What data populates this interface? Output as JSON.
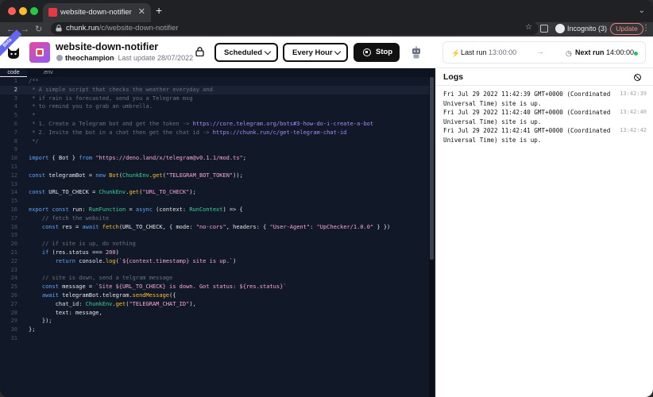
{
  "browser": {
    "tab_title": "website-down-notifier",
    "url_host": "chunk.run",
    "url_path": "/c/website-down-notifier",
    "incognito_label": "Incognito (3)",
    "update_label": "Update"
  },
  "header": {
    "beta_badge": "Beta",
    "title": "website-down-notifier",
    "owner": "theochampion",
    "last_update": "· Last update 28/07/2022",
    "schedule_label": "Scheduled",
    "frequency_label": "Every Hour",
    "stop_label": "Stop",
    "last_run_label": "Last run",
    "last_run_time": "13:00:00",
    "next_run_label": "Next run",
    "next_run_time": "14:00:00"
  },
  "editor": {
    "tabs": [
      "code",
      ".env"
    ],
    "active_tab": "code"
  },
  "logs": {
    "title": "Logs",
    "entries": [
      {
        "text": "Fri Jul 29 2022 11:42:39 GMT+0000 (Coordinated Universal Time) site is up.",
        "time": "13:42:39"
      },
      {
        "text": "Fri Jul 29 2022 11:42:40 GMT+0000 (Coordinated Universal Time) site is up.",
        "time": "13:42:40"
      },
      {
        "text": "Fri Jul 29 2022 11:42:41 GMT+0000 (Coordinated Universal Time) site is up.",
        "time": "13:42:42"
      }
    ]
  },
  "colors": {
    "accent": "#111111",
    "status_green": "#22c55e",
    "editor_bg": "#111827"
  }
}
